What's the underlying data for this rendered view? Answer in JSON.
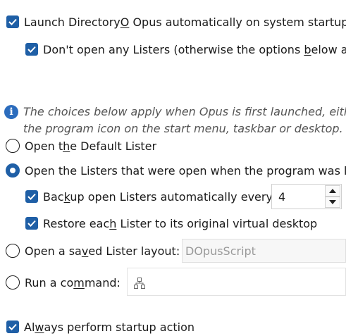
{
  "startup": {
    "launch_label_pre": "Launch Directory",
    "launch_label_u": "O",
    "launch_label_post": " Opus automatically on system startup",
    "no_listers_label_pre": "Don't open any Listers (otherwise the options ",
    "no_listers_label_u": "b",
    "no_listers_label_post": "elow ap"
  },
  "info": {
    "line1": "The choices below apply when Opus is first launched, eithe",
    "line2": "the program icon on the start menu, taskbar or desktop."
  },
  "options": {
    "default_lister_pre": "Open t",
    "default_lister_u": "h",
    "default_lister_post": "e Default Lister",
    "open_listers_label": "Open the Listers that were open when the program was la",
    "backup_pre": "Bac",
    "backup_u": "k",
    "backup_post": "up open Listers automatically every",
    "backup_value": "4",
    "restore_pre": "Restore eac",
    "restore_u": "h",
    "restore_post": " Lister to its original virtual desktop",
    "saved_layout_pre": "Open a sa",
    "saved_layout_u": "v",
    "saved_layout_post": "ed Lister layout:",
    "saved_layout_value": "DOpusScript",
    "run_command_pre": "Run a co",
    "run_command_u": "m",
    "run_command_post": "mand:"
  },
  "always": {
    "label_pre": "Al",
    "label_u": "w",
    "label_post": "ays perform startup action"
  },
  "colors": {
    "accent": "#1f5fa6",
    "text": "#1a1a1a",
    "info_text": "#555555",
    "disabled_text": "#9a9a9a"
  }
}
